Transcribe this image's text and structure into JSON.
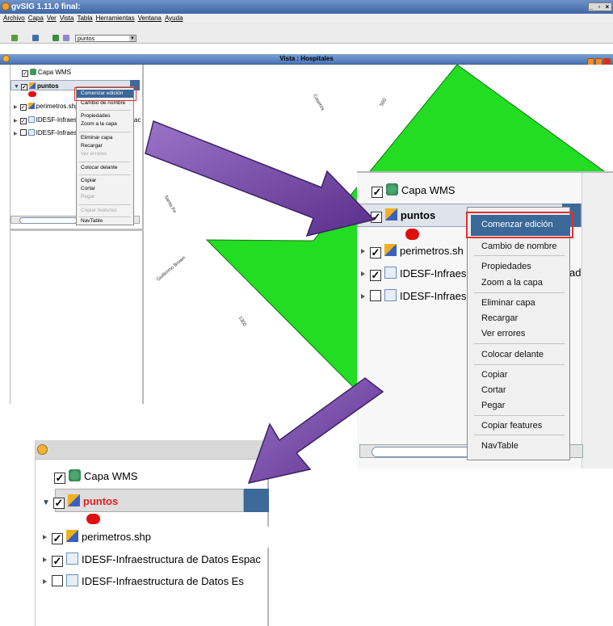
{
  "window": {
    "title": "gvSIG 1.11.0 final:",
    "controls": "_ ▫ ×",
    "menus": [
      "Archivo",
      "Capa",
      "Ver",
      "Vista",
      "Tabla",
      "Herramientas",
      "Ventana",
      "Ayuda"
    ],
    "layer_combo": "puntos"
  },
  "view": {
    "title": "Vista : Hospitales"
  },
  "toc": {
    "layers": [
      {
        "label": "Capa WMS",
        "checked": true
      },
      {
        "label": "puntos",
        "checked": true
      },
      {
        "label": "perimetros.shp",
        "checked": true
      },
      {
        "label": "IDESF-Infraes",
        "checked": true
      },
      {
        "label": "IDESF-Infraes",
        "checked": false
      }
    ],
    "overflow_text": "ac"
  },
  "map": {
    "streets": [
      "Caseros",
      "500",
      "Santa Fe",
      "Mar",
      "Guillermo Brown",
      "1300"
    ],
    "polygon_color": "#22dd22"
  },
  "context_menu": {
    "items": [
      {
        "label": "Comenzar edición",
        "disabled": false
      },
      {
        "label": "Cambio de nombre",
        "disabled": false
      },
      {
        "label": "Propiedades",
        "disabled": false
      },
      {
        "label": "Zoom a la capa",
        "disabled": false
      },
      {
        "label": "Eliminar capa",
        "disabled": false
      },
      {
        "label": "Recargar",
        "disabled": false
      },
      {
        "label": "Ver errores",
        "disabled": true
      },
      {
        "label": "Colocar delante",
        "disabled": false
      },
      {
        "label": "Copiar",
        "disabled": false
      },
      {
        "label": "Cortar",
        "disabled": false
      },
      {
        "label": "Pegar",
        "disabled": true
      },
      {
        "label": "Copiar features",
        "disabled": true
      },
      {
        "label": "NavTable",
        "disabled": false
      }
    ]
  },
  "zoom1": {
    "layers": [
      {
        "label": "Capa WMS"
      },
      {
        "label": "puntos"
      },
      {
        "label": "perimetros.sh"
      },
      {
        "label": "IDESF-Infraes"
      },
      {
        "label": "IDESF-Infraes"
      }
    ],
    "overflow_text": "ad"
  },
  "zoom2": {
    "layers": [
      {
        "label": "Capa WMS",
        "checked": true
      },
      {
        "label": "puntos",
        "checked": true
      },
      {
        "label": "perimetros.shp",
        "checked": true
      },
      {
        "label": "IDESF-Infraestructura de Datos Espac",
        "checked": true
      },
      {
        "label": "IDESF-Infraestructura de Datos Es",
        "checked": false
      }
    ]
  },
  "colors": {
    "selection_blue": "#3a6898",
    "highlight_red": "#e03030",
    "arrow_purple": "#7a4aa8",
    "editing_red": "#e01010"
  }
}
